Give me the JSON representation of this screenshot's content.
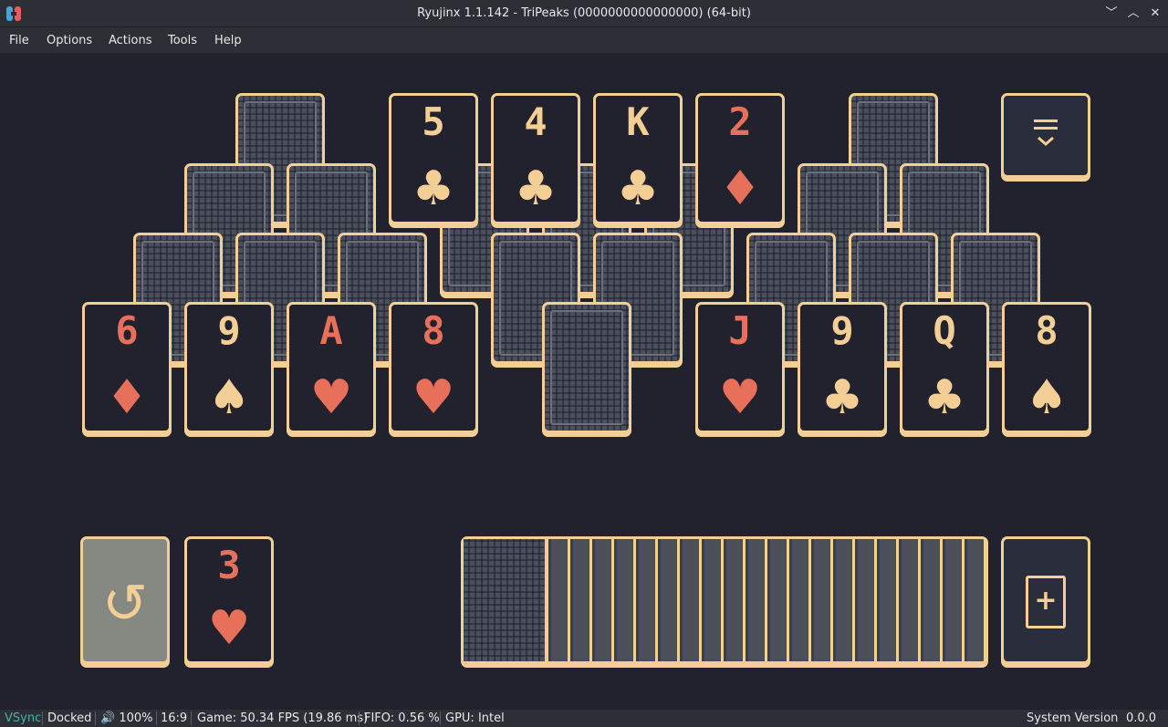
{
  "window": {
    "title": "Ryujinx 1.1.142 - TriPeaks (0000000000000000) (64-bit)",
    "controls": [
      "minimize",
      "maximize",
      "close"
    ]
  },
  "menu": {
    "items": [
      "File",
      "Options",
      "Actions",
      "Tools",
      "Help"
    ]
  },
  "colors": {
    "background": "#22222e",
    "card_border": "#f4cf95",
    "red_suit": "#e6705a",
    "tan_suit": "#f4cf95",
    "card_back": "#4b4f5c",
    "vsync_green": "#3fb6a8"
  },
  "game": {
    "peak_faces": [
      {
        "rank": "5",
        "suit": "♣",
        "color": "tan"
      },
      {
        "rank": "4",
        "suit": "♣",
        "color": "tan"
      },
      {
        "rank": "K",
        "suit": "♣",
        "color": "tan"
      },
      {
        "rank": "2",
        "suit": "♦",
        "color": "red"
      }
    ],
    "bottom_row": [
      {
        "rank": "6",
        "suit": "♦",
        "color": "red"
      },
      {
        "rank": "9",
        "suit": "♠",
        "color": "tan"
      },
      {
        "rank": "A",
        "suit": "♥",
        "color": "red"
      },
      {
        "rank": "8",
        "suit": "♥",
        "color": "red"
      },
      {
        "rank": "J",
        "suit": "♥",
        "color": "red"
      },
      {
        "rank": "9",
        "suit": "♣",
        "color": "tan"
      },
      {
        "rank": "Q",
        "suit": "♣",
        "color": "tan"
      },
      {
        "rank": "8",
        "suit": "♠",
        "color": "tan"
      }
    ],
    "waste_card": {
      "rank": "3",
      "suit": "♥",
      "color": "red"
    },
    "menu_icon": "hamburger-menu-icon",
    "undo_icon": "undo-icon",
    "draw_icon": "add-card-icon",
    "undo_glyph": "↺",
    "draw_glyph": "+"
  },
  "status": {
    "vsync": "VSync",
    "dock": "Docked",
    "volume": "🔊 100%",
    "aspect": "16:9",
    "fps": "Game: 50.34 FPS (19.86 ms)",
    "fifo": "FIFO: 0.56 %",
    "gpu": "GPU: Intel",
    "system_version_label": "System Version",
    "system_version": "0.0.0"
  }
}
